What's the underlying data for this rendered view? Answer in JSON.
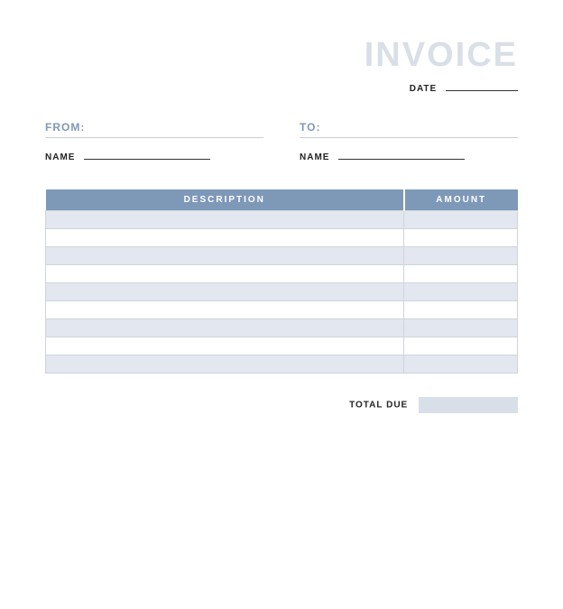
{
  "title": "INVOICE",
  "date": {
    "label": "DATE",
    "value": ""
  },
  "from": {
    "label": "FROM:",
    "name_label": "NAME",
    "name_value": ""
  },
  "to": {
    "label": "TO:",
    "name_label": "NAME",
    "name_value": ""
  },
  "table": {
    "headers": {
      "description": "DESCRIPTION",
      "amount": "AMOUNT"
    },
    "rows": [
      {
        "description": "",
        "amount": ""
      },
      {
        "description": "",
        "amount": ""
      },
      {
        "description": "",
        "amount": ""
      },
      {
        "description": "",
        "amount": ""
      },
      {
        "description": "",
        "amount": ""
      },
      {
        "description": "",
        "amount": ""
      },
      {
        "description": "",
        "amount": ""
      },
      {
        "description": "",
        "amount": ""
      },
      {
        "description": "",
        "amount": ""
      }
    ]
  },
  "total": {
    "label": "TOTAL DUE",
    "value": ""
  }
}
